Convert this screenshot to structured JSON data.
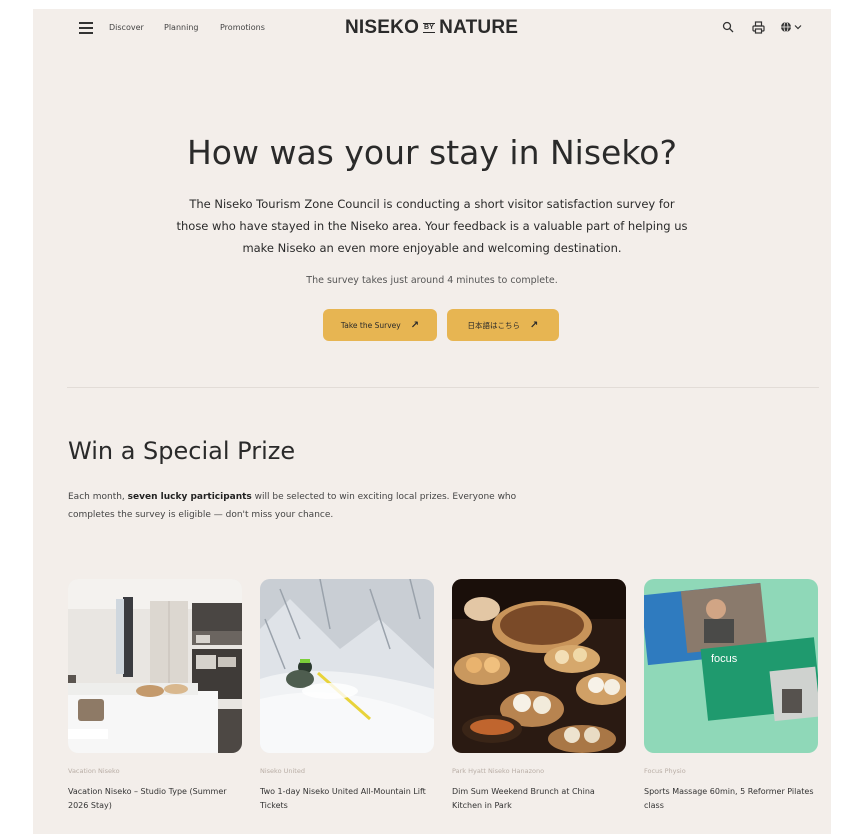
{
  "header": {
    "nav": [
      "Discover",
      "Planning",
      "Promotions"
    ],
    "logo_left": "NISEKO",
    "logo_by": "BY",
    "logo_right": "NATURE",
    "icons": [
      "menu-icon",
      "search-icon",
      "printer-icon",
      "globe-icon",
      "chevron-down-icon"
    ]
  },
  "hero": {
    "title": "How was your stay in Niseko?",
    "text": "The Niseko Tourism Zone Council is conducting a short visitor satisfaction survey for those who have stayed in the Niseko area. Your feedback is a valuable part of helping us make Niseko an even more enjoyable and welcoming destination.",
    "subtext": "The survey takes just around 4 minutes to complete.",
    "buttons": [
      {
        "label": "Take the Survey",
        "icon": "arrow-up-right-icon"
      },
      {
        "label": "日本語はこちら",
        "icon": "arrow-up-right-icon"
      }
    ]
  },
  "prize": {
    "title": "Win a Special Prize",
    "text_pre": "Each month, ",
    "text_bold": "seven lucky participants",
    "text_post": " will be selected to win exciting local prizes. Everyone who completes the survey is eligible — don't miss your chance.",
    "cards": [
      {
        "provider": "Vacation Niseko",
        "name": "Vacation Niseko – Studio Type (Summer 2026 Stay)"
      },
      {
        "provider": "Niseko United",
        "name": "Two 1-day Niseko United All-Mountain Lift Tickets"
      },
      {
        "provider": "Park Hyatt Niseko Hanazono",
        "name": "Dim Sum Weekend Brunch at China Kitchen in Park"
      },
      {
        "provider": "Focus Physio",
        "name": "Sports Massage 60min, 5 Reformer Pilates class"
      }
    ],
    "card_logo_text": "focus"
  },
  "colors": {
    "background": "#f3eeea",
    "button": "#e7b552",
    "text": "#2a2a2a"
  }
}
